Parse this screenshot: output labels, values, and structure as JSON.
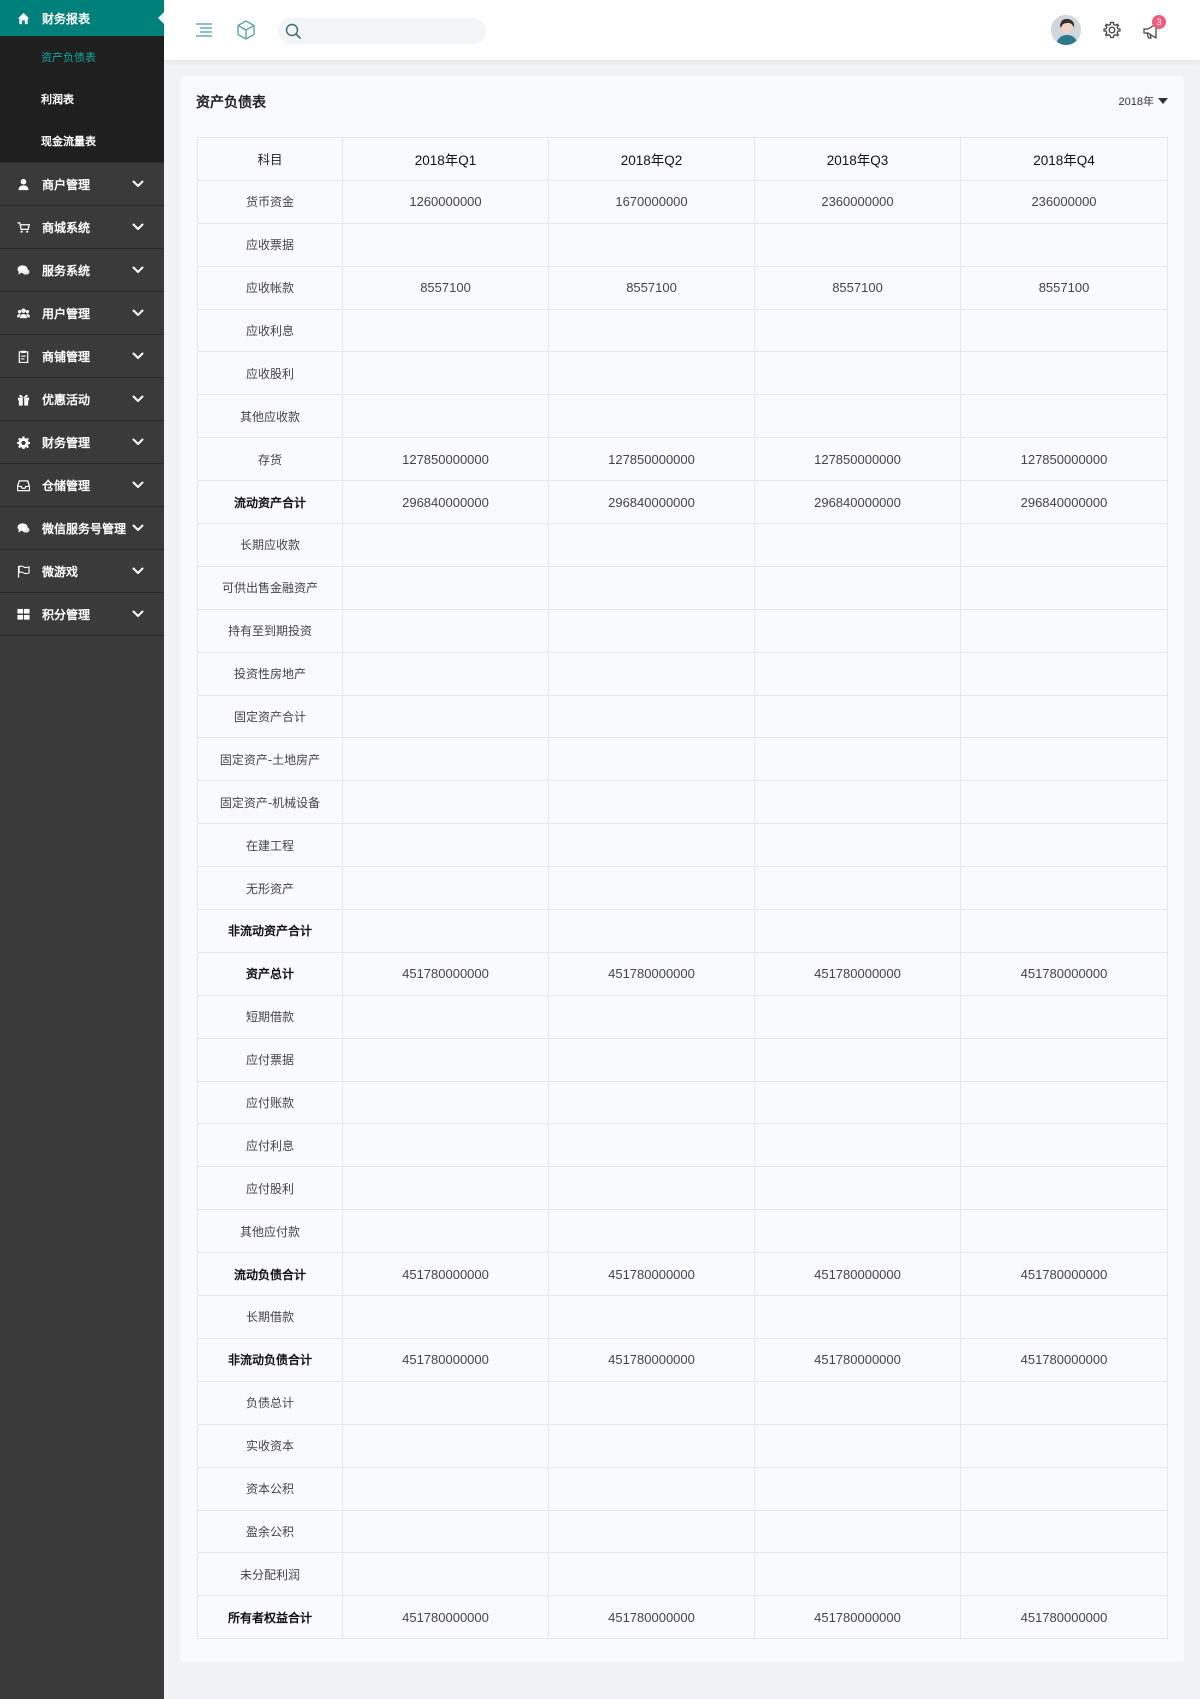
{
  "sidebar": {
    "groups": [
      {
        "label": "财务报表",
        "icon": "home-icon",
        "active": true,
        "sub": [
          {
            "label": "资产负债表",
            "active": true
          },
          {
            "label": "利润表",
            "active": false
          },
          {
            "label": "现金流量表",
            "active": false
          }
        ]
      },
      {
        "label": "商户管理",
        "icon": "user-icon"
      },
      {
        "label": "商城系统",
        "icon": "cart-icon"
      },
      {
        "label": "服务系统",
        "icon": "chat-icon"
      },
      {
        "label": "用户管理",
        "icon": "users-icon"
      },
      {
        "label": "商铺管理",
        "icon": "clipboard-icon"
      },
      {
        "label": "优惠活动",
        "icon": "gift-icon"
      },
      {
        "label": "财务管理",
        "icon": "gear-icon"
      },
      {
        "label": "仓储管理",
        "icon": "inbox-icon"
      },
      {
        "label": "微信服务号管理",
        "icon": "chat-icon"
      },
      {
        "label": "微游戏",
        "icon": "flag-icon"
      },
      {
        "label": "积分管理",
        "icon": "grid-icon"
      }
    ]
  },
  "header": {
    "search_placeholder": "",
    "notification_count": "3"
  },
  "colors": {
    "accent": "#00807a",
    "sidebar_bg": "#3a3a3a",
    "submenu_bg": "#1f1f1f",
    "badge": "#f25b7b"
  },
  "report": {
    "title": "资产负债表",
    "year": "2018年",
    "columns": [
      "科目",
      "2018年Q1",
      "2018年Q2",
      "2018年Q3",
      "2018年Q4"
    ],
    "rows": [
      {
        "label": "货币资金",
        "bold": false,
        "values": [
          "1260000000",
          "1670000000",
          "2360000000",
          "236000000"
        ]
      },
      {
        "label": "应收票据",
        "bold": false,
        "values": [
          "",
          "",
          "",
          ""
        ]
      },
      {
        "label": "应收帐款",
        "bold": false,
        "values": [
          "8557100",
          "8557100",
          "8557100",
          "8557100"
        ]
      },
      {
        "label": "应收利息",
        "bold": false,
        "values": [
          "",
          "",
          "",
          ""
        ]
      },
      {
        "label": "应收股利",
        "bold": false,
        "values": [
          "",
          "",
          "",
          ""
        ]
      },
      {
        "label": "其他应收款",
        "bold": false,
        "values": [
          "",
          "",
          "",
          ""
        ]
      },
      {
        "label": "存货",
        "bold": false,
        "values": [
          "127850000000",
          "127850000000",
          "127850000000",
          "127850000000"
        ]
      },
      {
        "label": "流动资产合计",
        "bold": true,
        "values": [
          "296840000000",
          "296840000000",
          "296840000000",
          "296840000000"
        ]
      },
      {
        "label": "长期应收款",
        "bold": false,
        "values": [
          "",
          "",
          "",
          ""
        ]
      },
      {
        "label": "可供出售金融资产",
        "bold": false,
        "values": [
          "",
          "",
          "",
          ""
        ]
      },
      {
        "label": "持有至到期投资",
        "bold": false,
        "values": [
          "",
          "",
          "",
          ""
        ]
      },
      {
        "label": "投资性房地产",
        "bold": false,
        "values": [
          "",
          "",
          "",
          ""
        ]
      },
      {
        "label": "固定资产合计",
        "bold": false,
        "values": [
          "",
          "",
          "",
          ""
        ]
      },
      {
        "label": "固定资产-土地房产",
        "bold": false,
        "values": [
          "",
          "",
          "",
          ""
        ]
      },
      {
        "label": "固定资产-机械设备",
        "bold": false,
        "values": [
          "",
          "",
          "",
          ""
        ]
      },
      {
        "label": "在建工程",
        "bold": false,
        "values": [
          "",
          "",
          "",
          ""
        ]
      },
      {
        "label": "无形资产",
        "bold": false,
        "values": [
          "",
          "",
          "",
          ""
        ]
      },
      {
        "label": "非流动资产合计",
        "bold": true,
        "values": [
          "",
          "",
          "",
          ""
        ]
      },
      {
        "label": "资产总计",
        "bold": true,
        "values": [
          "451780000000",
          "451780000000",
          "451780000000",
          "451780000000"
        ]
      },
      {
        "label": "短期借款",
        "bold": false,
        "values": [
          "",
          "",
          "",
          ""
        ]
      },
      {
        "label": "应付票据",
        "bold": false,
        "values": [
          "",
          "",
          "",
          ""
        ]
      },
      {
        "label": "应付账款",
        "bold": false,
        "values": [
          "",
          "",
          "",
          ""
        ]
      },
      {
        "label": "应付利息",
        "bold": false,
        "values": [
          "",
          "",
          "",
          ""
        ]
      },
      {
        "label": "应付股利",
        "bold": false,
        "values": [
          "",
          "",
          "",
          ""
        ]
      },
      {
        "label": "其他应付款",
        "bold": false,
        "values": [
          "",
          "",
          "",
          ""
        ]
      },
      {
        "label": "流动负债合计",
        "bold": true,
        "values": [
          "451780000000",
          "451780000000",
          "451780000000",
          "451780000000"
        ]
      },
      {
        "label": "长期借款",
        "bold": false,
        "values": [
          "",
          "",
          "",
          ""
        ]
      },
      {
        "label": "非流动负债合计",
        "bold": true,
        "values": [
          "451780000000",
          "451780000000",
          "451780000000",
          "451780000000"
        ]
      },
      {
        "label": "负债总计",
        "bold": false,
        "values": [
          "",
          "",
          "",
          ""
        ]
      },
      {
        "label": "实收资本",
        "bold": false,
        "values": [
          "",
          "",
          "",
          ""
        ]
      },
      {
        "label": "资本公积",
        "bold": false,
        "values": [
          "",
          "",
          "",
          ""
        ]
      },
      {
        "label": "盈余公积",
        "bold": false,
        "values": [
          "",
          "",
          "",
          ""
        ]
      },
      {
        "label": "未分配利润",
        "bold": false,
        "values": [
          "",
          "",
          "",
          ""
        ]
      },
      {
        "label": "所有者权益合计",
        "bold": true,
        "values": [
          "451780000000",
          "451780000000",
          "451780000000",
          "451780000000"
        ]
      }
    ]
  }
}
